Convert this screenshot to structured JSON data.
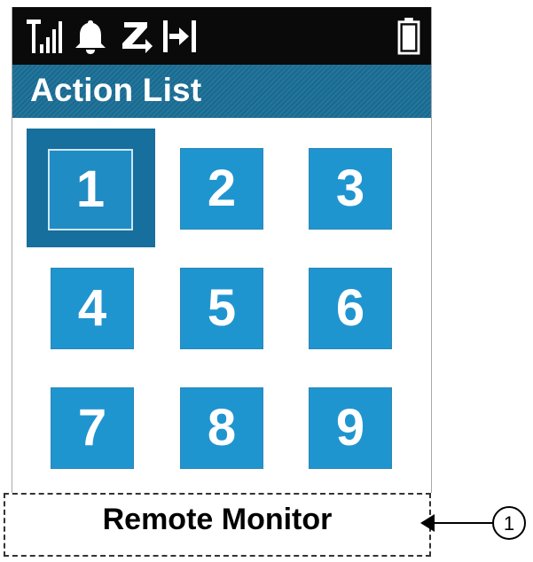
{
  "status_bar": {
    "icons": [
      "signal-strength-icon",
      "bell-icon",
      "scan-icon",
      "talkaround-icon",
      "battery-icon"
    ]
  },
  "header": {
    "title": "Action List"
  },
  "keypad": {
    "keys": [
      {
        "label": "1",
        "selected": true
      },
      {
        "label": "2",
        "selected": false
      },
      {
        "label": "3",
        "selected": false
      },
      {
        "label": "4",
        "selected": false
      },
      {
        "label": "5",
        "selected": false
      },
      {
        "label": "6",
        "selected": false
      },
      {
        "label": "7",
        "selected": false
      },
      {
        "label": "8",
        "selected": false
      },
      {
        "label": "9",
        "selected": false
      }
    ]
  },
  "footer": {
    "selected_action": "Remote Monitor"
  },
  "callout": {
    "number": "1"
  },
  "colors": {
    "status_bar_bg": "#0a0a0a",
    "title_bar_bg": "#1a6e96",
    "key_bg": "#1f95d0",
    "key_selected_bg": "#166f9c"
  }
}
